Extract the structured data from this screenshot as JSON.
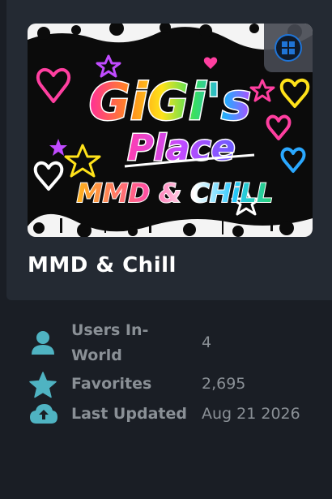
{
  "world": {
    "title": "MMD & Chill",
    "thumbnail_text": {
      "line1": "GiGi's",
      "line2": "Place",
      "line3": "MMD & CHiLL"
    },
    "platform_icon": "windows-icon"
  },
  "stats": [
    {
      "icon": "user-icon",
      "label": "Users In-World",
      "value": "4"
    },
    {
      "icon": "star-icon",
      "label": "Favorites",
      "value": "2,695"
    },
    {
      "icon": "cloud-upload-icon",
      "label": "Last Updated",
      "value": "Aug 21 2026"
    }
  ],
  "colors": {
    "background": "#1a1e25",
    "card": "#242a33",
    "icon_accent": "#4fb3c2",
    "stat_text": "#8a9096",
    "title_text": "#ffffff"
  }
}
